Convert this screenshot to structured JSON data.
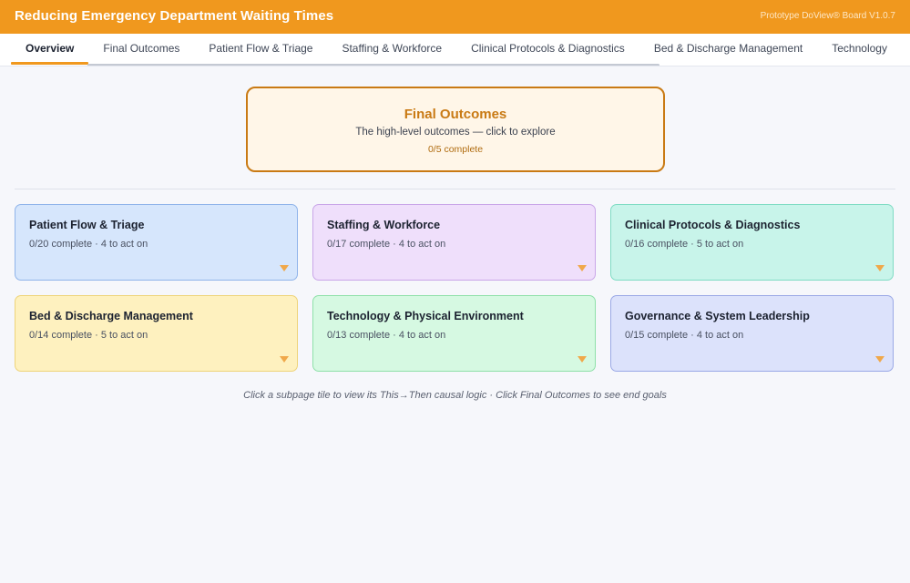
{
  "app": {
    "title": "Reducing Emergency Department Waiting Times",
    "version": "Prototype DoView® Board V1.0.7",
    "accent_color": "#f0981e"
  },
  "tabs": [
    {
      "label": "Overview",
      "active": true
    },
    {
      "label": "Final Outcomes",
      "active": false
    },
    {
      "label": "Patient Flow & Triage",
      "active": false
    },
    {
      "label": "Staffing & Workforce",
      "active": false
    },
    {
      "label": "Clinical Protocols & Diagnostics",
      "active": false
    },
    {
      "label": "Bed & Discharge Management",
      "active": false
    },
    {
      "label": "Technology",
      "active": false
    }
  ],
  "final_outcomes": {
    "title": "Final Outcomes",
    "description": "The high-level outcomes — click to explore",
    "progress": "0/5 complete"
  },
  "subpages": [
    {
      "title": "Patient Flow & Triage",
      "status": "0/20 complete · 4 to act on",
      "bg": "#d6e6fc",
      "border": "#8fb4ea",
      "caret_icon": "caret-down-icon"
    },
    {
      "title": "Staffing & Workforce",
      "status": "0/17 complete · 4 to act on",
      "bg": "#efdffb",
      "border": "#c9a6e8",
      "caret_icon": "caret-down-icon"
    },
    {
      "title": "Clinical Protocols & Diagnostics",
      "status": "0/16 complete · 5 to act on",
      "bg": "#c8f4ea",
      "border": "#7fdcc4",
      "caret_icon": "caret-down-icon"
    },
    {
      "title": "Bed & Discharge Management",
      "status": "0/14 complete · 5 to act on",
      "bg": "#fef1bf",
      "border": "#eed47a",
      "caret_icon": "caret-down-icon"
    },
    {
      "title": "Technology & Physical Environment",
      "status": "0/13 complete · 4 to act on",
      "bg": "#d6f9e2",
      "border": "#8fe0a9",
      "caret_icon": "caret-down-icon"
    },
    {
      "title": "Governance & System Leadership",
      "status": "0/15 complete · 4 to act on",
      "bg": "#dce2fb",
      "border": "#9ba9e6",
      "caret_icon": "caret-down-icon"
    }
  ],
  "hint": "Click a subpage tile to view its This→Then causal logic · Click Final Outcomes to see end goals"
}
